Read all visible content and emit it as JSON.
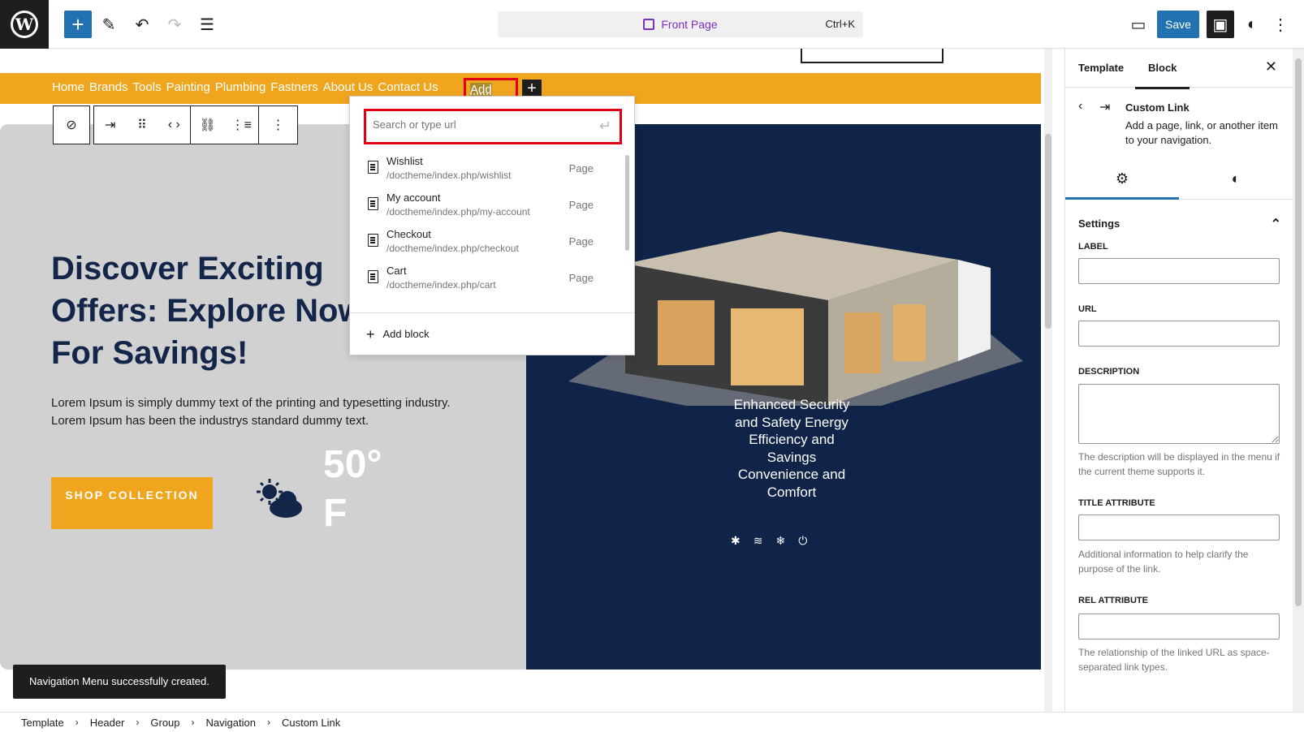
{
  "topbar": {
    "logo": "W",
    "add_icon": "+",
    "edit_icon": "✎",
    "undo_icon": "↶",
    "redo_icon": "↷",
    "list_view_icon": "☰",
    "command": {
      "title": "Front Page",
      "shortcut": "Ctrl+K"
    },
    "view_icon": "▭",
    "save_label": "Save",
    "sidebar_icon": "▣",
    "styles_icon": "◐",
    "options_icon": "⋮"
  },
  "navigation": {
    "items": [
      "Home",
      "Brands",
      "Tools",
      "Painting",
      "Plumbing",
      "Fastners",
      "About Us",
      "Contact Us"
    ],
    "add_link": "Add Link",
    "append_icon": "+"
  },
  "block_toolbar": {
    "compass_icon": "⊘",
    "block_icon": "⇥",
    "drag_icon": "⠿",
    "move_icon": "‹ ›",
    "link_icon": "⛓",
    "submenu_icon": "⋮≡",
    "more_icon": "⋮"
  },
  "link_popover": {
    "search_placeholder": "Search or type url",
    "enter_icon": "↵",
    "results": [
      {
        "title": "Wishlist",
        "url": "/doctheme/index.php/wishlist",
        "type": "Page"
      },
      {
        "title": "My account",
        "url": "/doctheme/index.php/my-account",
        "type": "Page"
      },
      {
        "title": "Checkout",
        "url": "/doctheme/index.php/checkout",
        "type": "Page"
      },
      {
        "title": "Cart",
        "url": "/doctheme/index.php/cart",
        "type": "Page"
      }
    ],
    "add_block": "Add block"
  },
  "hero": {
    "headline": "Discover Exciting Offers: Explore Now For Savings!",
    "lorem_1": "Lorem Ipsum is simply dummy text of the printing and typesetting industry.",
    "lorem_2": "Lorem Ipsum has been the industrys standard dummy text.",
    "shop_button": "SHOP COLLECTION",
    "temperature": "50° F",
    "features": "Enhanced Security and Safety Energy Efficiency and Savings Convenience and Comfort",
    "feature_icons": [
      "✱",
      "≋",
      "❄",
      "⏻"
    ]
  },
  "snackbar": "Navigation Menu successfully created.",
  "breadcrumb": [
    "Template",
    "Header",
    "Group",
    "Navigation",
    "Custom Link"
  ],
  "sidebar": {
    "tabs": [
      "Template",
      "Block"
    ],
    "close_icon": "✕",
    "block_name": "Custom Link",
    "block_desc": "Add a page, link, or another item to your navigation.",
    "settings_title": "Settings",
    "fields": {
      "label": "LABEL",
      "url": "URL",
      "description": "DESCRIPTION",
      "description_help": "The description will be displayed in the menu if the current theme supports it.",
      "title_attr": "TITLE ATTRIBUTE",
      "title_help": "Additional information to help clarify the purpose of the link.",
      "rel_attr": "REL ATTRIBUTE",
      "rel_help": "The relationship of the linked URL as space-separated link types."
    }
  },
  "colors": {
    "accent": "#2271b1",
    "nav_bar": "#f0a51f",
    "hero_dark": "#0f2448",
    "highlight": "#e00012"
  }
}
